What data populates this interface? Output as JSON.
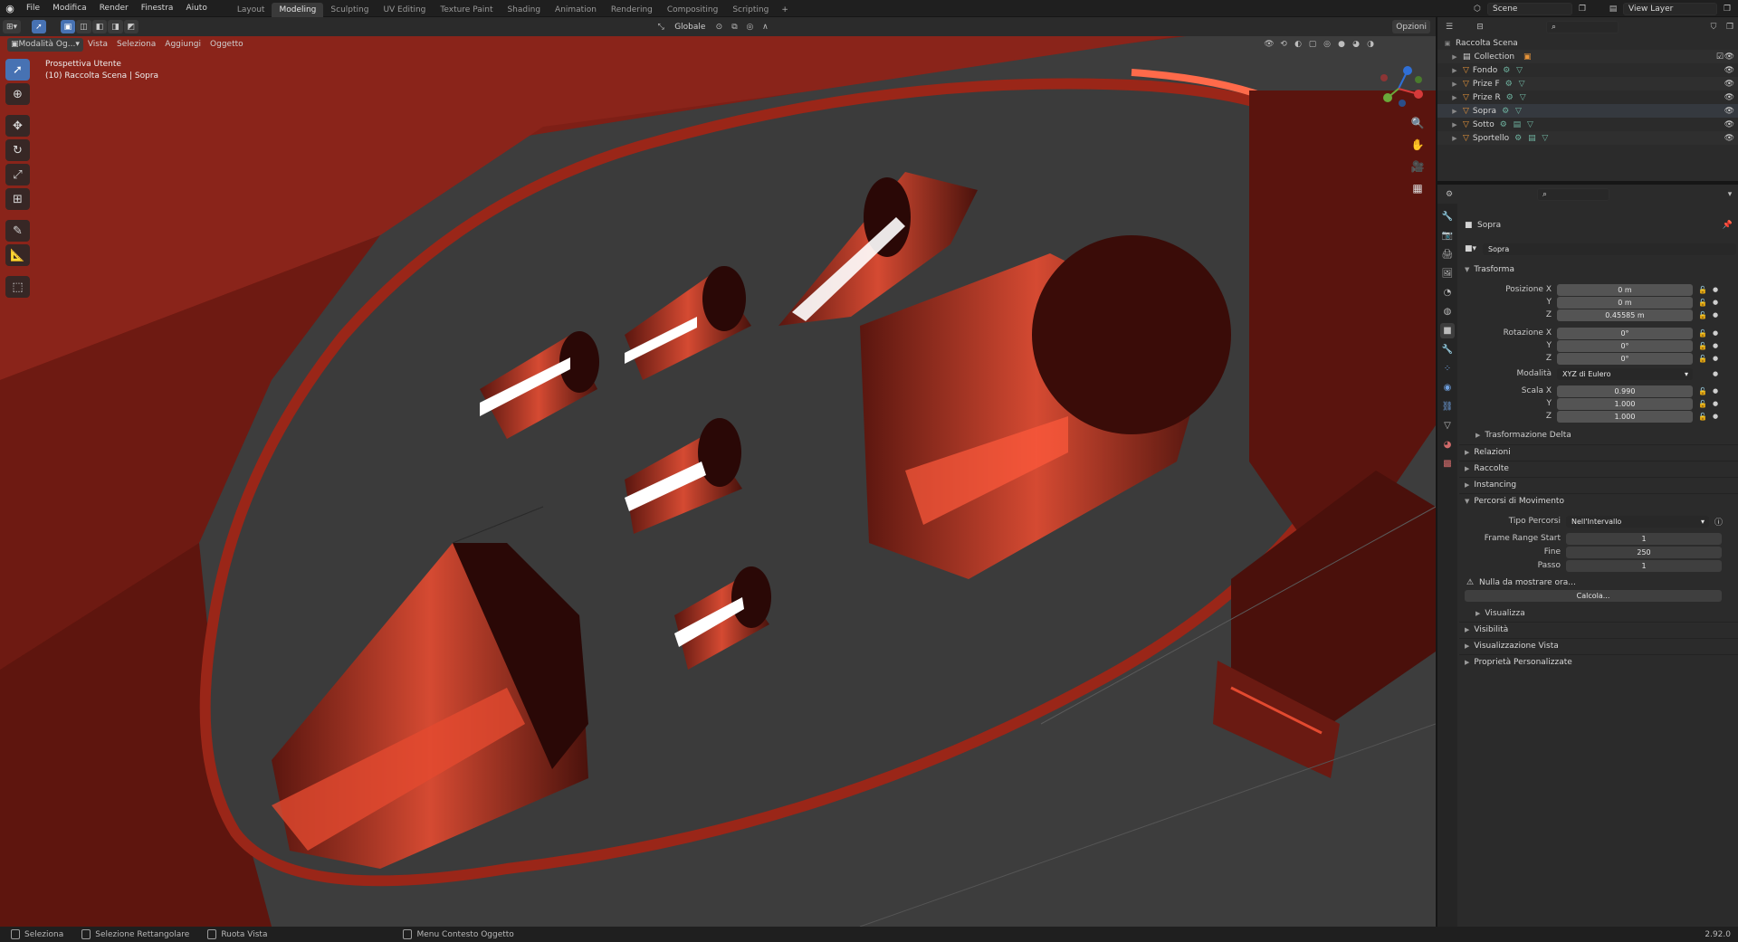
{
  "menus": [
    "File",
    "Modifica",
    "Render",
    "Finestra",
    "Aiuto"
  ],
  "workspace_tabs": [
    {
      "label": "Layout",
      "active": false
    },
    {
      "label": "Modeling",
      "active": true
    },
    {
      "label": "Sculpting",
      "active": false
    },
    {
      "label": "UV Editing",
      "active": false
    },
    {
      "label": "Texture Paint",
      "active": false
    },
    {
      "label": "Shading",
      "active": false
    },
    {
      "label": "Animation",
      "active": false
    },
    {
      "label": "Rendering",
      "active": false
    },
    {
      "label": "Compositing",
      "active": false
    },
    {
      "label": "Scripting",
      "active": false
    }
  ],
  "scene": {
    "name": "Scene"
  },
  "view_layer": {
    "name": "View Layer"
  },
  "viewport_header": {
    "transform_orientation": "Globale",
    "options_label": "Opzioni",
    "mode_label": "Modalità Og...",
    "menus": [
      "Vista",
      "Seleziona",
      "Aggiungi",
      "Oggetto"
    ]
  },
  "viewport": {
    "view_name": "Prospettiva Utente",
    "collection_info": "(10) Raccolta Scena | Sopra"
  },
  "outliner": {
    "root": "Raccolta Scena",
    "items": [
      {
        "name": "Collection",
        "type": "collection"
      },
      {
        "name": "Fondo",
        "type": "object"
      },
      {
        "name": "Prize F",
        "type": "object"
      },
      {
        "name": "Prize R",
        "type": "object"
      },
      {
        "name": "Sopra",
        "type": "object"
      },
      {
        "name": "Sotto",
        "type": "object"
      },
      {
        "name": "Sportello",
        "type": "object"
      }
    ]
  },
  "properties": {
    "object_name": "Sopra",
    "object_field": "Sopra",
    "transform": {
      "title": "Trasforma",
      "position_label": "Posizione X",
      "position": [
        "0 m",
        "0 m",
        "0.45585 m"
      ],
      "rotation_label": "Rotazione X",
      "rotation": [
        "0°",
        "0°",
        "0°"
      ],
      "mode_label": "Modalità",
      "mode_value": "XYZ di Eulero",
      "scale_label": "Scala X",
      "scale": [
        "0.990",
        "1.000",
        "1.000"
      ],
      "axis_y": "Y",
      "axis_z": "Z",
      "delta": "Trasformazione Delta"
    },
    "panels_collapsed": [
      "Relazioni",
      "Raccolte",
      "Instancing"
    ],
    "motion_paths": {
      "title": "Percorsi di Movimento",
      "type_label": "Tipo Percorsi",
      "type_value": "Nell'Intervallo",
      "frame_start_label": "Frame Range Start",
      "frame_start": "1",
      "end_label": "Fine",
      "end": "250",
      "step_label": "Passo",
      "step": "1",
      "warning": "Nulla da mostrare ora...",
      "calculate": "Calcola...",
      "display": "Visualizza"
    },
    "panels_bottom": [
      "Visibilità",
      "Visualizzazione Vista",
      "Proprietà Personalizzate"
    ]
  },
  "statusbar": {
    "items": [
      "Seleziona",
      "Selezione Rettangolare",
      "Ruota Vista",
      "Menu Contesto Oggetto"
    ],
    "version": "2.92.0"
  },
  "colors": {
    "accent": "#4772b3",
    "object_red": "#a1281a",
    "highlight": "#ff5a3c",
    "ground": "#3d3d3d"
  }
}
